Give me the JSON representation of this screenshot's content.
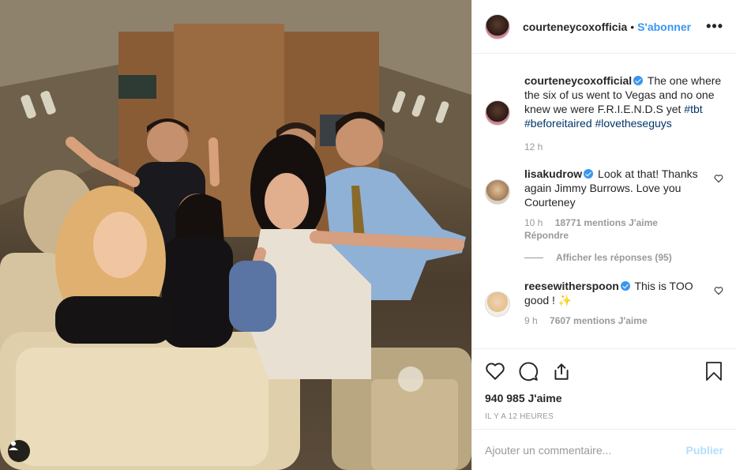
{
  "post": {
    "author": "courteneycoxofficia",
    "follow_separator": "•",
    "follow_label": "S'abonner",
    "more_label": "•••"
  },
  "caption": {
    "username": "courteneycoxofficial",
    "text": "The one where the six of us went to Vegas and no one knew we were F.R.I.E.N.D.S yet",
    "hashtags": "#tbt #beforeitaired #lovetheseguys",
    "time": "12 h"
  },
  "comments": [
    {
      "username": "lisakudrow",
      "text": "Look at that! Thanks again Jimmy Burrows. Love you Courteney",
      "time": "10 h",
      "likes": "18771 mentions J'aime",
      "reply_label": "Répondre",
      "view_replies": "Afficher les réponses (95)"
    },
    {
      "username": "reesewitherspoon",
      "text": "This is TOO good ! ✨",
      "time": "9 h",
      "likes": "7607 mentions J'aime"
    }
  ],
  "footer": {
    "likes": "940 985 J'aime",
    "timestamp": "IL Y A 12 HEURES",
    "comment_placeholder": "Ajouter un commentaire...",
    "post_label": "Publier"
  },
  "icons": {
    "like": "heart-icon",
    "comment": "comment-icon",
    "share": "share-icon",
    "save": "bookmark-icon",
    "tags": "user-tag-icon"
  },
  "colors": {
    "link_blue": "#3897f0",
    "hashtag": "#003569",
    "muted": "#999999",
    "post_disabled": "#b2dffc"
  }
}
